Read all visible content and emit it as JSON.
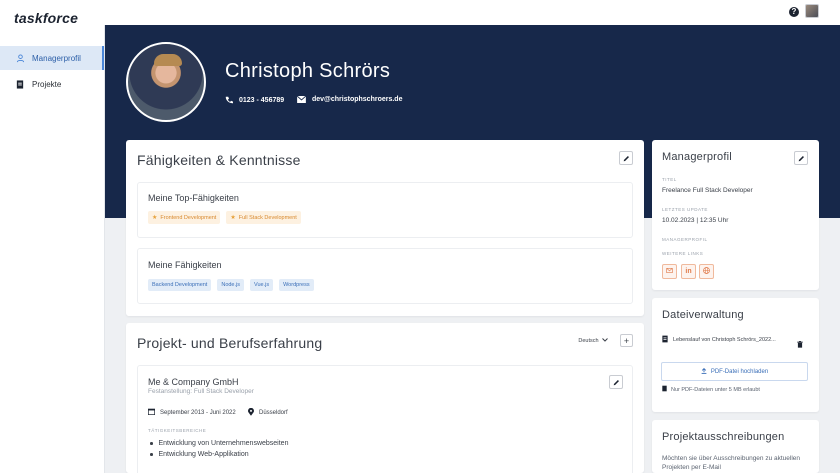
{
  "app": {
    "logo": "taskforce"
  },
  "topbar": {
    "help_icon": "help-circle-icon",
    "avatar_icon": "user-avatar"
  },
  "sidebar": {
    "items": [
      {
        "label": "Managerprofil",
        "icon": "user-icon",
        "active": true
      },
      {
        "label": "Projekte",
        "icon": "document-icon",
        "active": false
      }
    ]
  },
  "profile": {
    "name": "Christoph Schrörs",
    "phone": "0123 - 456789",
    "email": "dev@christophschroers.de"
  },
  "skills": {
    "title": "Fähigkeiten & Kenntnisse",
    "top_title": "Meine Top-Fähigkeiten",
    "top_items": [
      "Frontend Development",
      "Full Stack Development"
    ],
    "all_title": "Meine Fähigkeiten",
    "all_items": [
      "Backend Development",
      "Node.js",
      "Vue.js",
      "Wordpress"
    ]
  },
  "experience": {
    "title": "Projekt- und Berufserfahrung",
    "language": "Deutsch",
    "entry": {
      "company": "Me & Company GmbH",
      "position": "Festanstellung: Full Stack Developer",
      "period": "September 2013 - Juni 2022",
      "location": "Düsseldorf",
      "section_label": "Tätigkeitsbereiche",
      "bullets": [
        "Entwicklung von Unternehmenswebseiten",
        "Entwicklung Web-Applikation"
      ]
    }
  },
  "manager": {
    "title": "Managerprofil",
    "titel_label": "Titel",
    "titel_value": "Freelance Full Stack Developer",
    "updated_label": "Letztes Update",
    "updated_value": "10.02.2023 | 12:35 Uhr",
    "profile_label": "Managerprofil",
    "links_label": "Weitere Links",
    "social_icons": [
      "mail-icon",
      "linkedin-icon",
      "globe-icon"
    ],
    "linkedin_text": "in"
  },
  "files": {
    "title": "Dateiverwaltung",
    "file_name": "Lebenslauf von Christoph Schrörs_2022...",
    "upload_label": "PDF-Datei hochladen",
    "hint": "Nur PDF-Dateien unter 5 MB erlaubt"
  },
  "tenders": {
    "title": "Projektausschreibungen",
    "text": "Möchten sie über Ausschreibungen zu aktuellen Projekten per E-Mail"
  },
  "colors": {
    "hero": "#17284a",
    "accent": "#4a86d8",
    "orange": "#d8892e"
  }
}
